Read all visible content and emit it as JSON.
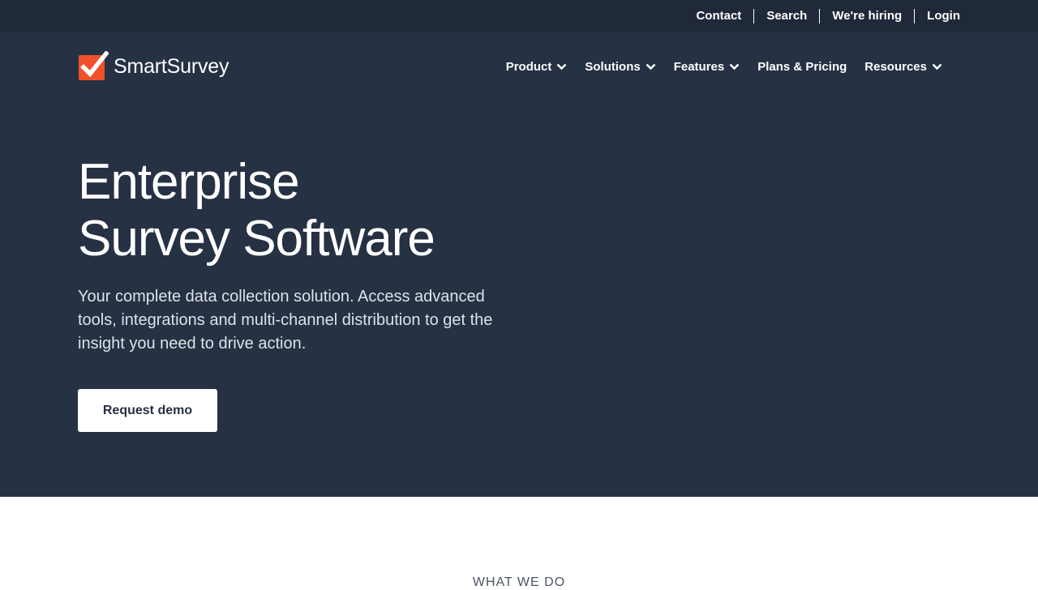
{
  "utility_nav": {
    "items": [
      "Contact",
      "Search",
      "We're hiring",
      "Login"
    ]
  },
  "brand": {
    "name": "SmartSurvey",
    "logo_icon": "checkmark-box-icon",
    "accent_color": "#f0512b"
  },
  "main_nav": {
    "items": [
      {
        "label": "Product",
        "has_dropdown": true
      },
      {
        "label": "Solutions",
        "has_dropdown": true
      },
      {
        "label": "Features",
        "has_dropdown": true
      },
      {
        "label": "Plans & Pricing",
        "has_dropdown": false
      },
      {
        "label": "Resources",
        "has_dropdown": true
      }
    ]
  },
  "hero": {
    "title_line1": "Enterprise",
    "title_line2": "Survey Software",
    "description": "Your complete data collection solution. Access advanced tools, integrations and multi-channel distribution to get the insight you need to drive action.",
    "cta_label": "Request demo",
    "background_color": "#273144"
  },
  "section": {
    "eyebrow": "WHAT WE DO"
  }
}
